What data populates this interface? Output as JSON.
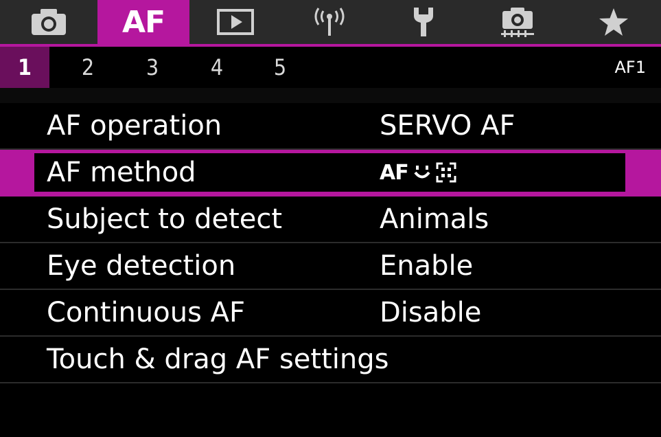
{
  "category_tabs": [
    {
      "name": "camera-icon",
      "active": false
    },
    {
      "name": "AF",
      "label": "AF",
      "active": true
    },
    {
      "name": "playback-icon",
      "active": false
    },
    {
      "name": "wireless-icon",
      "active": false
    },
    {
      "name": "wrench-icon",
      "active": false
    },
    {
      "name": "custom-functions-icon",
      "active": false
    },
    {
      "name": "star-icon",
      "active": false
    }
  ],
  "pages": {
    "items": [
      "1",
      "2",
      "3",
      "4",
      "5"
    ],
    "active_index": 0,
    "id": "AF1"
  },
  "menu": {
    "items": [
      {
        "label": "AF operation",
        "value": "SERVO AF"
      },
      {
        "label": "AF method",
        "value_icon": "af-face-tracking-icon",
        "value_text": "AF"
      },
      {
        "label": "Subject to detect",
        "value": "Animals"
      },
      {
        "label": "Eye detection",
        "value": "Enable"
      },
      {
        "label": "Continuous AF",
        "value": "Disable"
      },
      {
        "label": "Touch & drag AF settings",
        "value": ""
      }
    ],
    "selected_index": 1
  },
  "colors": {
    "accent": "#b5179e",
    "accent_dark": "#6a0f5c",
    "tab_bar": "#2a2a2a",
    "background": "#000000"
  }
}
